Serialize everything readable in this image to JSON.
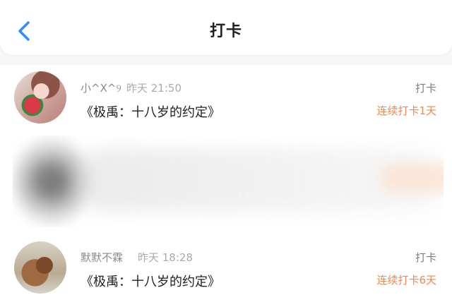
{
  "header": {
    "title": "打卡"
  },
  "icons": {
    "back": "back-icon"
  },
  "colors": {
    "accent": "#2f8cff",
    "streak": "#f0884a"
  },
  "list": [
    {
      "name": "小^X^୨",
      "time": "昨天 21:50",
      "book": "《极禹：十八岁的约定》",
      "tag": "打卡",
      "streak": "连续打卡1天"
    },
    {
      "name": "默默不霖",
      "time": "昨天 18:28",
      "book": "《极禹：十八岁的约定》",
      "tag": "打卡",
      "streak": "连续打卡6天"
    }
  ]
}
